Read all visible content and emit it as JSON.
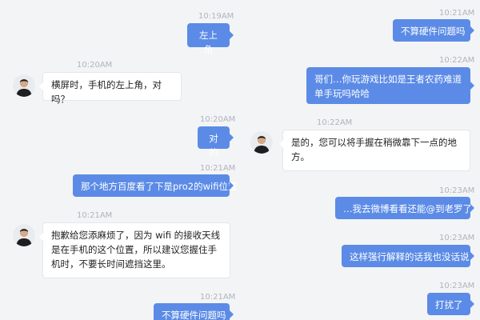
{
  "colors": {
    "outgoing_bubble": "#5b8be6",
    "incoming_bubble": "#ffffff",
    "timestamp": "#b0b4ba",
    "background": "#f3f4f6"
  },
  "left_column": {
    "messages": [
      {
        "type": "outgoing",
        "time": "10:19AM",
        "text": "左上角"
      },
      {
        "type": "incoming",
        "time": "10:20AM",
        "text": "横屏时，手机的左上角，对吗？",
        "avatar": "avatar-icon"
      },
      {
        "type": "outgoing",
        "time": "10:20AM",
        "text": "对的"
      },
      {
        "type": "outgoing",
        "time": "10:21AM",
        "text": "那个地方百度看了下是pro2的wifi位置"
      },
      {
        "type": "incoming",
        "time": "10:21AM",
        "text": "抱歉给您添麻烦了，因为 wifi 的接收天线是在手机的这个位置，所以建议您握住手机时，不要长时间遮挡这里。",
        "avatar": "avatar-icon"
      },
      {
        "type": "outgoing",
        "time": "10:21AM",
        "text": "不算硬件问题吗"
      }
    ]
  },
  "right_column": {
    "messages": [
      {
        "type": "outgoing",
        "time": "10:21AM",
        "text": "不算硬件问题吗"
      },
      {
        "type": "outgoing",
        "time": "10:22AM",
        "text": "哥们…你玩游戏比如是王者农药难道单手玩吗哈哈"
      },
      {
        "type": "incoming",
        "time": "10:22AM",
        "text": "是的，您可以将手握在稍微靠下一点的地方。",
        "avatar": "avatar-icon"
      },
      {
        "type": "outgoing",
        "time": "10:23AM",
        "text": "…我去微博看看还能@到老罗了"
      },
      {
        "type": "outgoing",
        "time": "10:23AM",
        "text": "这样强行解释的话我也没话说"
      },
      {
        "type": "outgoing",
        "time": "10:23AM",
        "text": "打扰了"
      }
    ]
  }
}
